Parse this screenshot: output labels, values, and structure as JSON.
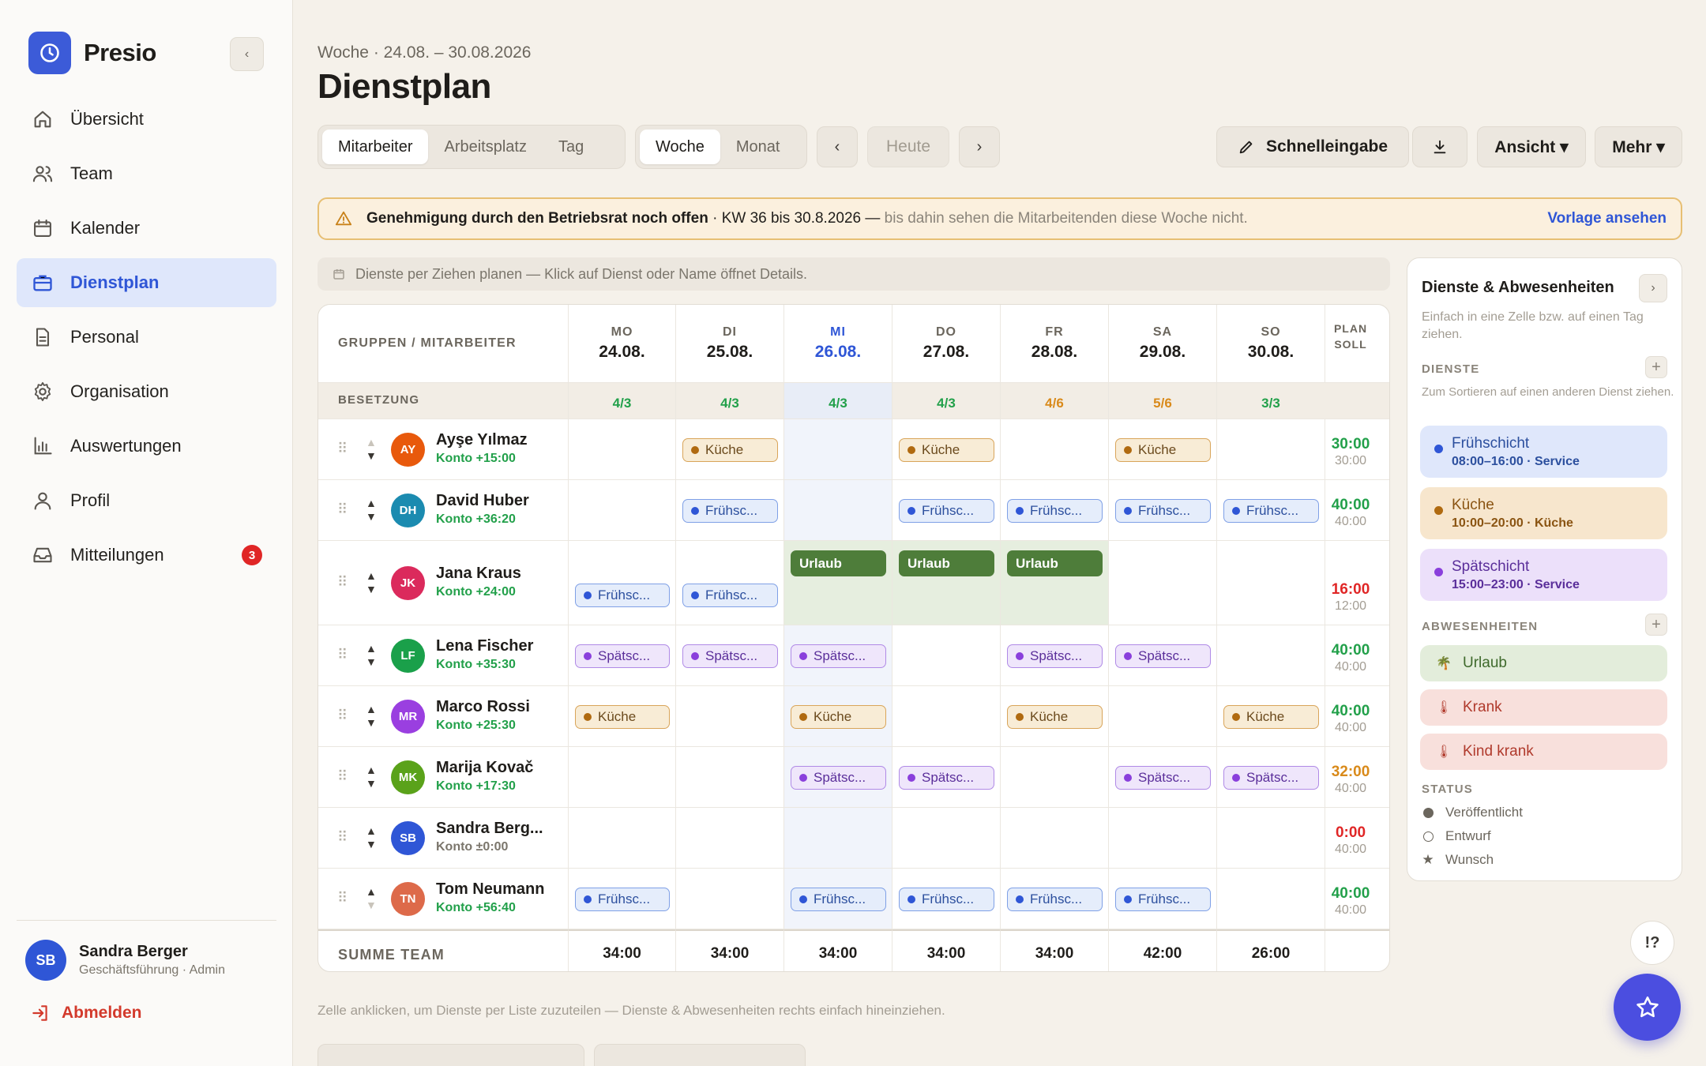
{
  "app": {
    "name": "Presio"
  },
  "nav": [
    {
      "label": "Übersicht",
      "icon": "home-icon"
    },
    {
      "label": "Team",
      "icon": "users-icon"
    },
    {
      "label": "Kalender",
      "icon": "calendar-icon"
    },
    {
      "label": "Dienstplan",
      "icon": "briefcase-icon",
      "active": true
    },
    {
      "label": "Personal",
      "icon": "document-icon"
    },
    {
      "label": "Organisation",
      "icon": "gear-icon"
    },
    {
      "label": "Auswertungen",
      "icon": "bar-chart-icon"
    },
    {
      "label": "Profil",
      "icon": "user-icon"
    },
    {
      "label": "Mitteilungen",
      "icon": "inbox-icon",
      "badge": "3"
    }
  ],
  "user": {
    "initials": "SB",
    "name": "Sandra Berger",
    "role": "Geschäftsführung · Admin",
    "logout": "Abmelden"
  },
  "page": {
    "subtitle": "Woche · 24.08. – 30.08.2026",
    "title": "Dienstplan"
  },
  "toolbar": {
    "view_tabs": [
      "Mitarbeiter",
      "Arbeitsplatz",
      "Tag"
    ],
    "period_tabs": [
      "Woche",
      "Monat"
    ],
    "today": "Heute",
    "quick_entry": "Schnelleingabe",
    "view": "Ansicht ▾",
    "more": "Mehr ▾"
  },
  "warning": {
    "bold": "Genehmigung durch den Betriebsrat noch offen",
    "text": " · KW 36 bis 30.8.2026 —",
    "muted": " bis dahin sehen die Mitarbeitenden diese Woche nicht.",
    "link": "Vorlage ansehen"
  },
  "hint": "Dienste per Ziehen planen — Klick auf Dienst oder Name öffnet Details.",
  "grid": {
    "header_label": "GRUPPEN / MITARBEITER",
    "plan_label_1": "PLAN",
    "plan_label_2": "SOLL",
    "days": [
      {
        "name": "MO",
        "date": "24.08."
      },
      {
        "name": "DI",
        "date": "25.08."
      },
      {
        "name": "MI",
        "date": "26.08.",
        "today": true
      },
      {
        "name": "DO",
        "date": "27.08."
      },
      {
        "name": "FR",
        "date": "28.08."
      },
      {
        "name": "SA",
        "date": "29.08."
      },
      {
        "name": "SO",
        "date": "30.08."
      }
    ],
    "staffing_label": "BESETZUNG",
    "staffing": [
      {
        "value": "4/3",
        "color": "#22a04a"
      },
      {
        "value": "4/3",
        "color": "#22a04a"
      },
      {
        "value": "4/3",
        "color": "#22a04a"
      },
      {
        "value": "4/3",
        "color": "#22a04a"
      },
      {
        "value": "4/6",
        "color": "#d98a1a"
      },
      {
        "value": "5/6",
        "color": "#d98a1a"
      },
      {
        "value": "3/3",
        "color": "#22a04a"
      }
    ],
    "employees": [
      {
        "initials": "AY",
        "name": "Ayşe Yılmaz",
        "konto": "Konto +15:00",
        "konto_color": "#22a04a",
        "avatar_color": "#e8590c",
        "up_disabled": true,
        "down_disabled": false,
        "plan": "30:00",
        "plan_color": "#22a04a",
        "soll": "30:00",
        "shifts": [
          null,
          {
            "type": "kueche",
            "label": "Küche"
          },
          null,
          {
            "type": "kueche",
            "label": "Küche"
          },
          null,
          {
            "type": "kueche",
            "label": "Küche"
          },
          null
        ]
      },
      {
        "initials": "DH",
        "name": "David Huber",
        "konto": "Konto +36:20",
        "konto_color": "#22a04a",
        "avatar_color": "#1b8bb0",
        "plan": "40:00",
        "plan_color": "#22a04a",
        "soll": "40:00",
        "shifts": [
          null,
          {
            "type": "frueh",
            "label": "Frühsc..."
          },
          null,
          {
            "type": "frueh",
            "label": "Frühsc..."
          },
          {
            "type": "frueh",
            "label": "Frühsc..."
          },
          {
            "type": "frueh",
            "label": "Frühsc..."
          },
          {
            "type": "frueh",
            "label": "Frühsc..."
          }
        ]
      },
      {
        "initials": "JK",
        "name": "Jana Kraus",
        "konto": "Konto +24:00",
        "konto_color": "#22a04a",
        "avatar_color": "#db2a5c",
        "plan": "16:00",
        "plan_color": "#e02626",
        "soll": "12:00",
        "shifts": [
          {
            "type": "frueh",
            "label": "Frühsc..."
          },
          {
            "type": "frueh",
            "label": "Frühsc..."
          },
          {
            "type": "urlaub",
            "label": "Urlaub"
          },
          {
            "type": "urlaub",
            "label": "Urlaub"
          },
          {
            "type": "urlaub",
            "label": "Urlaub"
          },
          null,
          null
        ]
      },
      {
        "initials": "LF",
        "name": "Lena Fischer",
        "konto": "Konto +35:30",
        "konto_color": "#22a04a",
        "avatar_color": "#1aa04a",
        "plan": "40:00",
        "plan_color": "#22a04a",
        "soll": "40:00",
        "shifts": [
          {
            "type": "spaet",
            "label": "Spätsc..."
          },
          {
            "type": "spaet",
            "label": "Spätsc..."
          },
          {
            "type": "spaet",
            "label": "Spätsc..."
          },
          null,
          {
            "type": "spaet",
            "label": "Spätsc..."
          },
          {
            "type": "spaet",
            "label": "Spätsc..."
          },
          null
        ]
      },
      {
        "initials": "MR",
        "name": "Marco Rossi",
        "konto": "Konto +25:30",
        "konto_color": "#22a04a",
        "avatar_color": "#9a3fe0",
        "plan": "40:00",
        "plan_color": "#22a04a",
        "soll": "40:00",
        "shifts": [
          {
            "type": "kueche",
            "label": "Küche"
          },
          null,
          {
            "type": "kueche",
            "label": "Küche"
          },
          null,
          {
            "type": "kueche",
            "label": "Küche"
          },
          null,
          {
            "type": "kueche",
            "label": "Küche"
          }
        ]
      },
      {
        "initials": "MK",
        "name": "Marija Kovač",
        "konto": "Konto +17:30",
        "konto_color": "#22a04a",
        "avatar_color": "#5aa21a",
        "plan": "32:00",
        "plan_color": "#d98a1a",
        "soll": "40:00",
        "shifts": [
          null,
          null,
          {
            "type": "spaet",
            "label": "Spätsc..."
          },
          {
            "type": "spaet",
            "label": "Spätsc..."
          },
          null,
          {
            "type": "spaet",
            "label": "Spätsc..."
          },
          {
            "type": "spaet",
            "label": "Spätsc..."
          }
        ]
      },
      {
        "initials": "SB",
        "name": "Sandra Berg...",
        "konto": "Konto ±0:00",
        "konto_color": "#7b766c",
        "avatar_color": "#2f56d6",
        "plan": "0:00",
        "plan_color": "#e02626",
        "soll": "40:00",
        "shifts": [
          null,
          null,
          null,
          null,
          null,
          null,
          null
        ]
      },
      {
        "initials": "TN",
        "name": "Tom Neumann",
        "konto": "Konto +56:40",
        "konto_color": "#22a04a",
        "avatar_color": "#dd6a4a",
        "up_disabled": false,
        "down_disabled": true,
        "plan": "40:00",
        "plan_color": "#22a04a",
        "soll": "40:00",
        "shifts": [
          {
            "type": "frueh",
            "label": "Frühsc..."
          },
          null,
          {
            "type": "frueh",
            "label": "Frühsc..."
          },
          {
            "type": "frueh",
            "label": "Frühsc..."
          },
          {
            "type": "frueh",
            "label": "Frühsc..."
          },
          {
            "type": "frueh",
            "label": "Frühsc..."
          },
          null
        ]
      }
    ],
    "sum_label": "SUMME TEAM",
    "sums": [
      "34:00",
      "34:00",
      "34:00",
      "34:00",
      "34:00",
      "42:00",
      "26:00"
    ]
  },
  "panel": {
    "title": "Dienste & Abwesenheiten",
    "subtitle": "Einfach in eine Zelle bzw. auf einen Tag ziehen.",
    "services_label": "DIENSTE",
    "services_hint": "Zum Sortieren auf einen anderen Dienst ziehen.",
    "services": [
      {
        "name": "Frühschicht",
        "time": "08:00–16:00 · Service",
        "bg": "#dfe7fb",
        "fg": "#2c4f9e",
        "dot": "#2f56d6"
      },
      {
        "name": "Küche",
        "time": "10:00–20:00 · Küche",
        "bg": "#f7e6cd",
        "fg": "#8a5412",
        "dot": "#b06a10"
      },
      {
        "name": "Spätschicht",
        "time": "15:00–23:00 · Service",
        "bg": "#ece0fa",
        "fg": "#5a2e9a",
        "dot": "#8a3fdc"
      }
    ],
    "absences_label": "ABWESENHEITEN",
    "absences": [
      {
        "name": "Urlaub",
        "icon": "palm-icon",
        "glyph": "🌴",
        "bg": "#e3eddb",
        "fg": "#3f6a2c"
      },
      {
        "name": "Krank",
        "icon": "thermometer-icon",
        "glyph": "🌡",
        "bg": "#f8e0dc",
        "fg": "#b03a2c"
      },
      {
        "name": "Kind krank",
        "icon": "thermometer-icon",
        "glyph": "🌡",
        "bg": "#f8e0dc",
        "fg": "#b03a2c"
      }
    ],
    "status_label": "STATUS",
    "statuses": [
      "Veröffentlicht",
      "Entwurf",
      "Wunsch"
    ]
  },
  "footnote": "Zelle anklicken, um Dienste per Liste zuzuteilen — Dienste & Abwesenheiten rechts einfach hineinziehen.",
  "help": "!?"
}
